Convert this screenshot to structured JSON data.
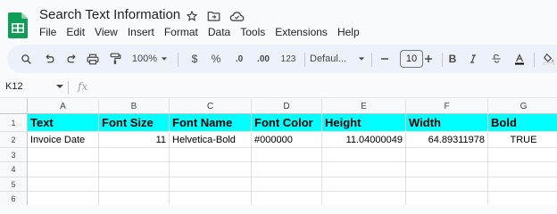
{
  "app": {
    "title": "Search Text Information",
    "menu": [
      "File",
      "Edit",
      "View",
      "Insert",
      "Format",
      "Data",
      "Tools",
      "Extensions",
      "Help"
    ]
  },
  "toolbar": {
    "zoom": "100%",
    "currency": "$",
    "percent": "%",
    "decrease_decimal": ".0",
    "increase_decimal": ".00",
    "number_format": "123",
    "font_family": "Defaul...",
    "font_size": "10",
    "bold": "B"
  },
  "formula_bar": {
    "cell_ref": "K12",
    "fx": "fx"
  },
  "sheet": {
    "columns": [
      "A",
      "B",
      "C",
      "D",
      "E",
      "F",
      "G"
    ],
    "rows": [
      "1",
      "2",
      "3",
      "4",
      "5",
      "6"
    ],
    "header_row": [
      "Text",
      "Font Size",
      "Font Name",
      "Font Color",
      "Height",
      "Width",
      "Bold"
    ],
    "data_row": [
      "Invoice Date",
      "11",
      "Helvetica-Bold",
      "#000000",
      "11.04000049",
      "64.89311978",
      "TRUE"
    ],
    "header_fill": "#00ffff"
  },
  "colors": {
    "sheets_green": "#0f9d58",
    "toolbar_bg": "#edf2fa"
  }
}
